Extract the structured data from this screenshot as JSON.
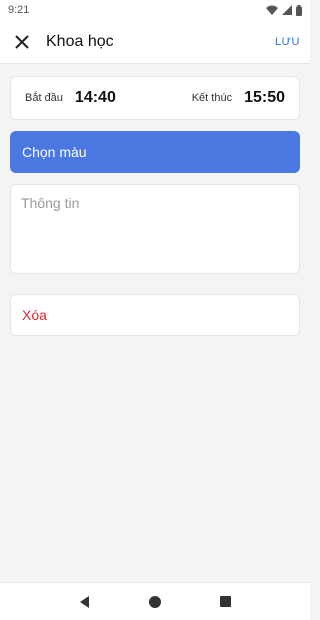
{
  "status_bar": {
    "time": "9:21",
    "icons": [
      "wifi-icon",
      "signal-icon",
      "battery-icon"
    ]
  },
  "app_bar": {
    "close_icon": "close-icon",
    "title": "Khoa học",
    "save_label": "LƯU"
  },
  "time_range": {
    "start_label": "Bắt đầu",
    "start_value": "14:40",
    "end_label": "Kết thúc",
    "end_value": "15:50"
  },
  "color_button": {
    "label": "Chọn màu",
    "color": "#4a78e0"
  },
  "info_field": {
    "value": "",
    "placeholder": "Thông tin"
  },
  "delete_button": {
    "label": "Xóa",
    "color": "#e5262e"
  },
  "nav_bar": {
    "icons": [
      "back-icon",
      "home-icon",
      "recents-icon"
    ]
  }
}
